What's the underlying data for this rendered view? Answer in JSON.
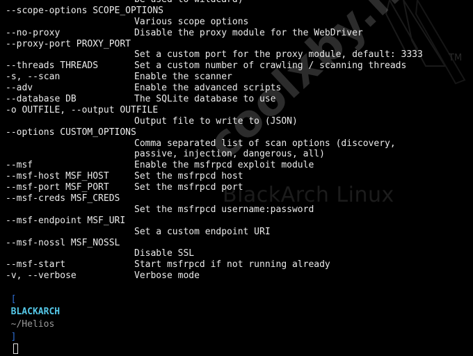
{
  "terminal": {
    "lines": [
      {
        "opt": "",
        "desc": "be used to wildcard)"
      },
      {
        "opt": "--scope-options SCOPE_OPTIONS",
        "desc": ""
      },
      {
        "opt": "",
        "desc": "Various scope options"
      },
      {
        "opt": "--no-proxy",
        "desc": "Disable the proxy module for the WebDriver"
      },
      {
        "opt": "--proxy-port PROXY_PORT",
        "desc": ""
      },
      {
        "opt": "",
        "desc": "Set a custom port for the proxy module, default: 3333"
      },
      {
        "opt": "--threads THREADS",
        "desc": "Set a custom number of crawling / scanning threads"
      },
      {
        "opt": "-s, --scan",
        "desc": "Enable the scanner"
      },
      {
        "opt": "--adv",
        "desc": "Enable the advanced scripts"
      },
      {
        "opt": "--database DB",
        "desc": "The SQLite database to use"
      },
      {
        "opt": "-o OUTFILE, --output OUTFILE",
        "desc": ""
      },
      {
        "opt": "",
        "desc": "Output file to write to (JSON)"
      },
      {
        "opt": "--options CUSTOM_OPTIONS",
        "desc": ""
      },
      {
        "opt": "",
        "desc": "Comma separated list of scan options (discovery,"
      },
      {
        "opt": "",
        "desc": "passive, injection, dangerous, all)"
      },
      {
        "opt": "--msf",
        "desc": "Enable the msfrpcd exploit module"
      },
      {
        "opt": "--msf-host MSF_HOST",
        "desc": "Set the msfrpcd host"
      },
      {
        "opt": "--msf-port MSF_PORT",
        "desc": "Set the msfrpcd port"
      },
      {
        "opt": "--msf-creds MSF_CREDS",
        "desc": ""
      },
      {
        "opt": "",
        "desc": "Set the msfrpcd username:password"
      },
      {
        "opt": "--msf-endpoint MSF_URI",
        "desc": ""
      },
      {
        "opt": "",
        "desc": "Set a custom endpoint URI"
      },
      {
        "opt": "--msf-nossl MSF_NOSSL",
        "desc": ""
      },
      {
        "opt": "",
        "desc": "Disable SSL"
      },
      {
        "opt": "--msf-start",
        "desc": "Start msfrpcd if not running already"
      },
      {
        "opt": "-v, --verbose",
        "desc": "Verbose mode"
      }
    ]
  },
  "prompt": {
    "open_bracket": "[",
    "host": "BLACKARCH",
    "path": "~/Helios",
    "close_bracket": "]"
  },
  "background": {
    "brand_text": "BlackArch Linux",
    "trademark": "TM",
    "watermark": "coolxby.net"
  },
  "colors": {
    "background": "#000000",
    "text": "#ebebeb",
    "prompt_bracket": "#2f6fd6",
    "prompt_host": "#55c8e8",
    "prompt_path": "#9a9a9a"
  }
}
